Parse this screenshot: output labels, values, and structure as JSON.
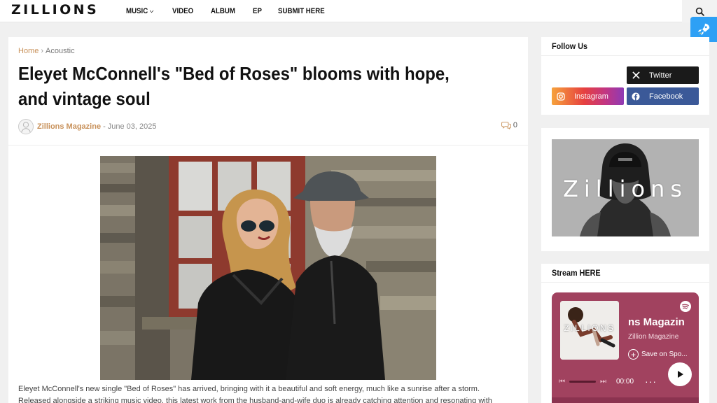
{
  "header": {
    "logo": "ZILLIONS",
    "nav": [
      {
        "label": "MUSIC",
        "has_dropdown": true
      },
      {
        "label": "VIDEO"
      },
      {
        "label": "ALBUM"
      },
      {
        "label": "EP"
      },
      {
        "label": "SUBMIT HERE"
      }
    ],
    "search_icon": "search-icon",
    "floating_icon": "rocket-icon"
  },
  "post": {
    "breadcrumb": {
      "home": "Home",
      "separator": "›",
      "category": "Acoustic"
    },
    "title": "Eleyet McConnell's \"Bed of Roses\" blooms with hope, and vintage soul",
    "author": "Zillions Magazine",
    "date_separator": "-",
    "date": "June 03, 2025",
    "comments_count": "0",
    "paragraph": "Eleyet McConnell's new single \"Bed of Roses\" has arrived, bringing with it a beautiful and soft energy, much like a sunrise after a storm. Released alongside a striking music video, this latest work from the husband-and-wife duo is already catching attention and resonating with listeners worldwide."
  },
  "sidebar": {
    "follow": {
      "title": "Follow Us",
      "buttons": [
        {
          "label": "Twitter",
          "icon": "x-icon"
        },
        {
          "label": "Instagram",
          "icon": "instagram-icon"
        },
        {
          "label": "Facebook",
          "icon": "facebook-icon"
        }
      ]
    },
    "banner": {
      "text": "Zillions"
    },
    "stream": {
      "title": "Stream HERE",
      "player": {
        "cover_text": "ZILLIONS",
        "title": "ns Magazin",
        "subtitle": "Zillion Magazine",
        "save_label": "Save on Spo...",
        "time": "00:00",
        "more": "···"
      }
    }
  },
  "colors": {
    "accent": "#c8915a",
    "twitter": "#1a1a1a",
    "facebook": "#3b5998",
    "spotify_card": "#a1425f",
    "rocket": "#2ea0f5"
  }
}
